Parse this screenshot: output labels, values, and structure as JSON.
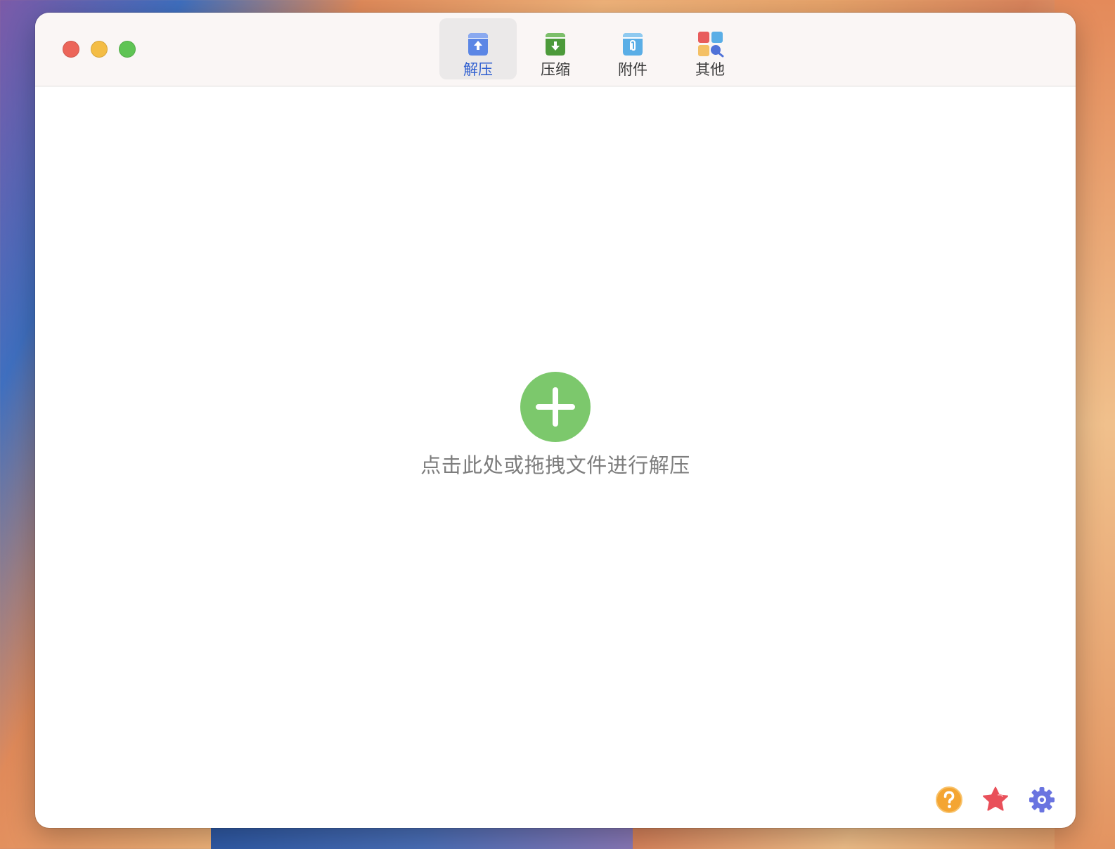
{
  "window": {
    "controls": {
      "close": "close",
      "minimize": "minimize",
      "zoom": "zoom"
    }
  },
  "toolbar": {
    "tabs": [
      {
        "id": "extract",
        "label": "解压",
        "icon": "box-upload-icon",
        "color": "#5b86e5",
        "active": true
      },
      {
        "id": "compress",
        "label": "压缩",
        "icon": "box-download-icon",
        "color": "#4c9a3a",
        "active": false
      },
      {
        "id": "attachment",
        "label": "附件",
        "icon": "box-paperclip-icon",
        "color": "#5aaee6",
        "active": false
      },
      {
        "id": "other",
        "label": "其他",
        "icon": "apps-search-icon",
        "color": "#e85c5c",
        "active": false
      }
    ]
  },
  "main": {
    "add_icon": "plus-icon",
    "add_color": "#7cc86c",
    "hint": "点击此处或拖拽文件进行解压"
  },
  "footer": {
    "actions": [
      {
        "id": "help",
        "icon": "question-circle-icon",
        "color": "#f4a532"
      },
      {
        "id": "favorite",
        "icon": "star-icon",
        "color": "#e9505a"
      },
      {
        "id": "settings",
        "icon": "gear-icon",
        "color": "#6a74e0"
      }
    ]
  }
}
